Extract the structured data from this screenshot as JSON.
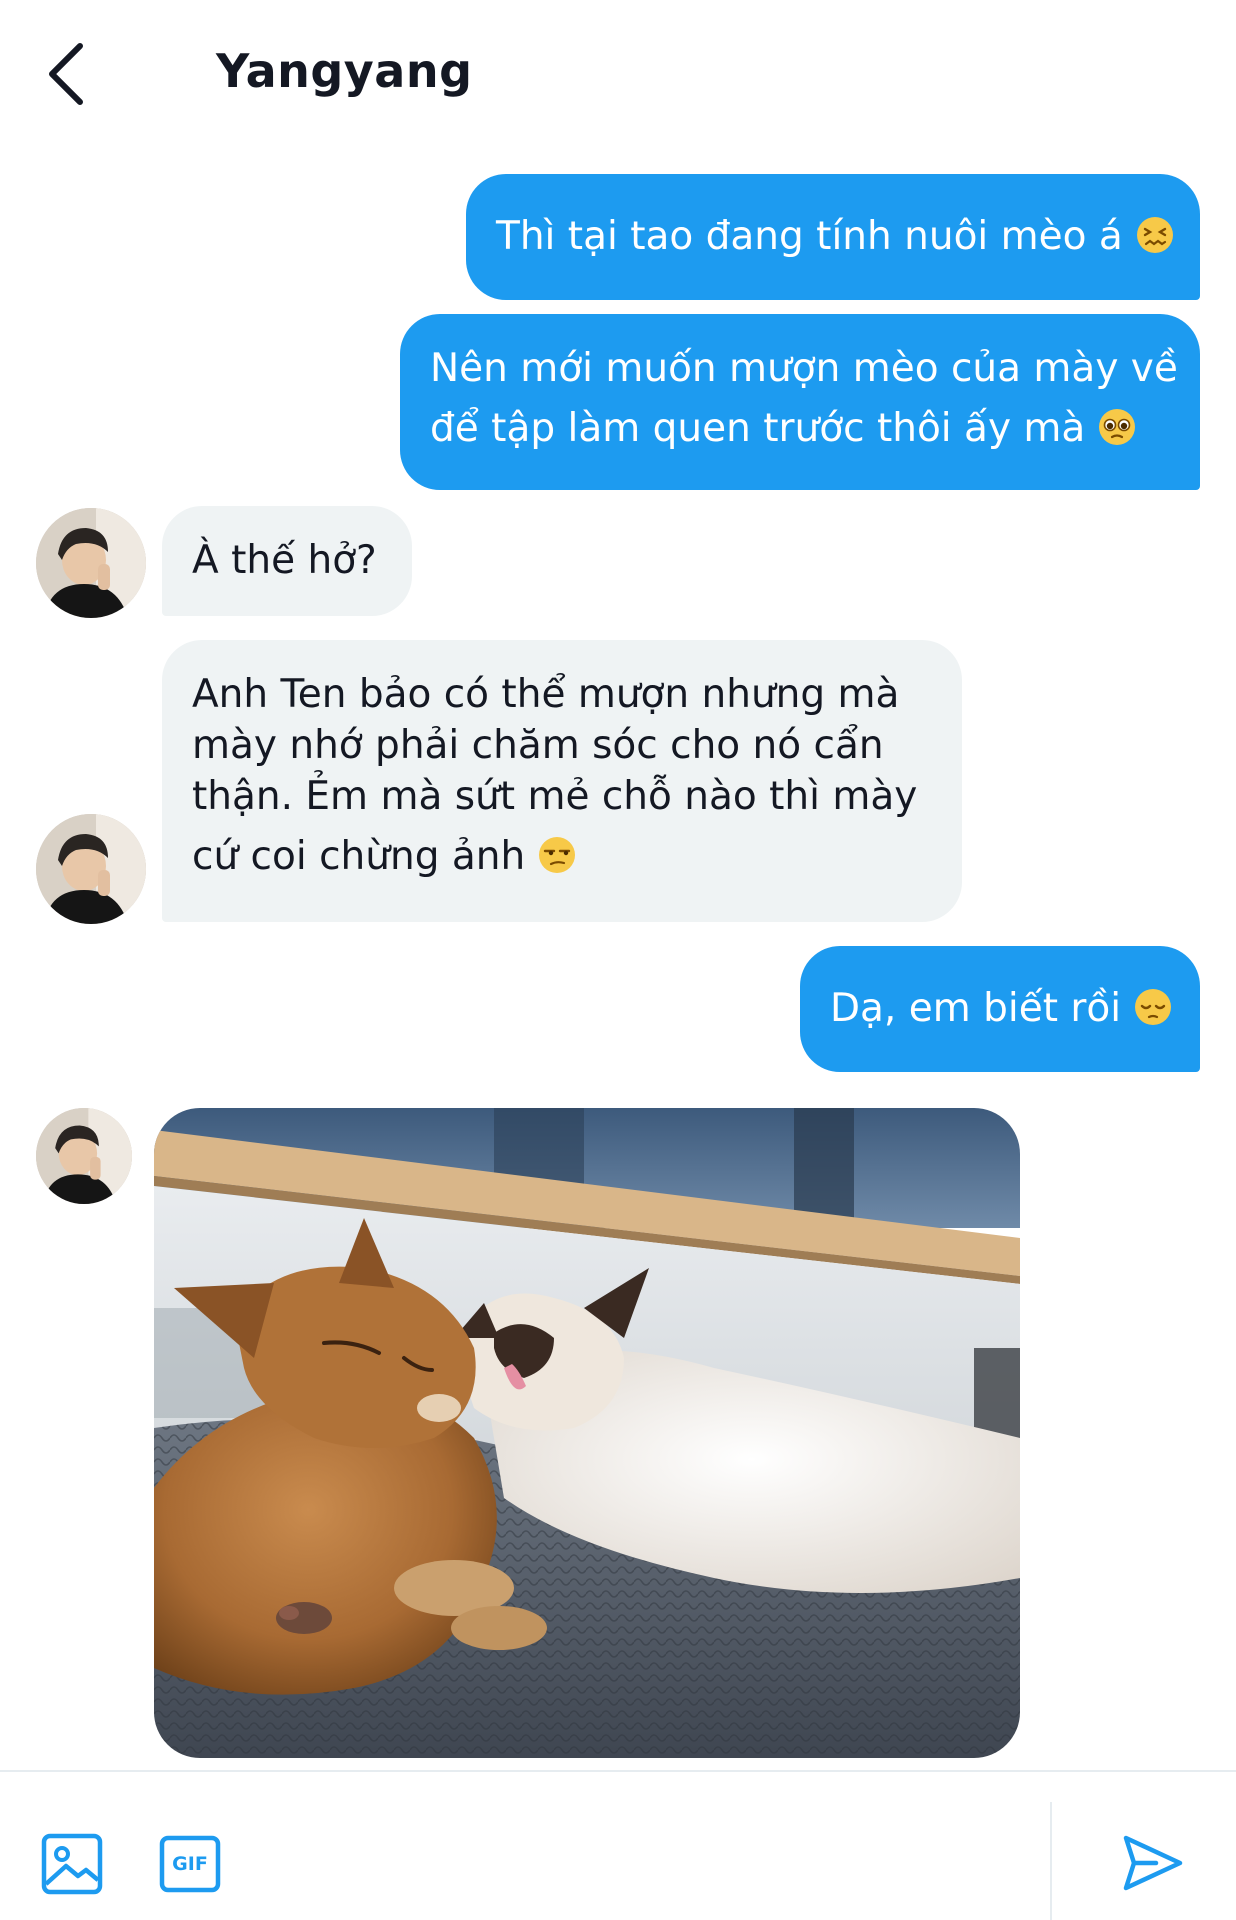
{
  "header": {
    "title": "Yangyang",
    "back_icon": "chevron-left-icon"
  },
  "colors": {
    "outgoing_bubble": "#1d9bf0",
    "incoming_bubble": "#eff3f4",
    "accent": "#1d9bf0"
  },
  "messages": [
    {
      "direction": "outgoing",
      "lines": [
        "Thì tại tao đang tính nuôi mèo á"
      ],
      "emoji": "confounded-face"
    },
    {
      "direction": "outgoing",
      "lines": [
        "Nên mới muốn mượn mèo của mày về",
        "để tập làm quen trước thôi ấy mà"
      ],
      "emoji": "pleading-face"
    },
    {
      "direction": "incoming",
      "lines": [
        "À thế hở?"
      ]
    },
    {
      "direction": "incoming",
      "lines": [
        "Anh Ten bảo có thể mượn nhưng mà",
        "mày nhớ phải chăm sóc cho nó cẩn",
        "thận. Ẻm mà sứt mẻ chỗ nào thì mày",
        "cứ coi chừng ảnh"
      ],
      "emoji": "unamused-face"
    },
    {
      "direction": "outgoing",
      "lines": [
        "Dạ, em biết rồi"
      ],
      "emoji": "pensive-face"
    },
    {
      "direction": "incoming",
      "type": "photo",
      "description_icon": "cats-photo"
    }
  ],
  "composer": {
    "image_icon": "image-icon",
    "gif_label": "GIF",
    "send_icon": "send-icon"
  }
}
